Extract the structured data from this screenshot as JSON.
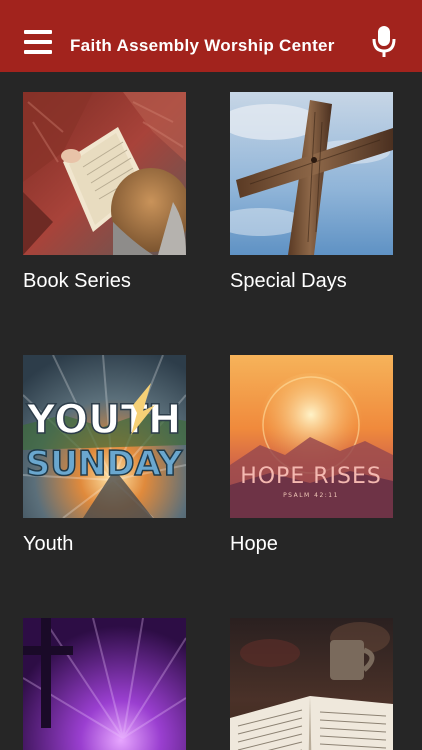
{
  "header": {
    "title": "Faith Assembly Worship Center",
    "menu_icon": "hamburger-menu-icon",
    "mic_icon": "microphone-icon",
    "background_color": "#a2231d"
  },
  "grid": {
    "items": [
      {
        "label": "Book Series",
        "thumbnail": "reading-book-image"
      },
      {
        "label": "Special Days",
        "thumbnail": "wooden-cross-sky-image"
      },
      {
        "label": "Youth",
        "thumbnail": "youth-sunday-image",
        "artwork_text": {
          "line1": "YOUTH",
          "line2": "SUNDAY"
        }
      },
      {
        "label": "Hope",
        "thumbnail": "hope-rises-image",
        "artwork_text": {
          "line1": "HOPE RISES",
          "line2": "PSALM 42:11"
        }
      },
      {
        "label": "",
        "thumbnail": "purple-cross-rays-image"
      },
      {
        "label": "",
        "thumbnail": "open-bible-coffee-image"
      }
    ]
  },
  "colors": {
    "background": "#262626",
    "text": "#ffffff"
  }
}
